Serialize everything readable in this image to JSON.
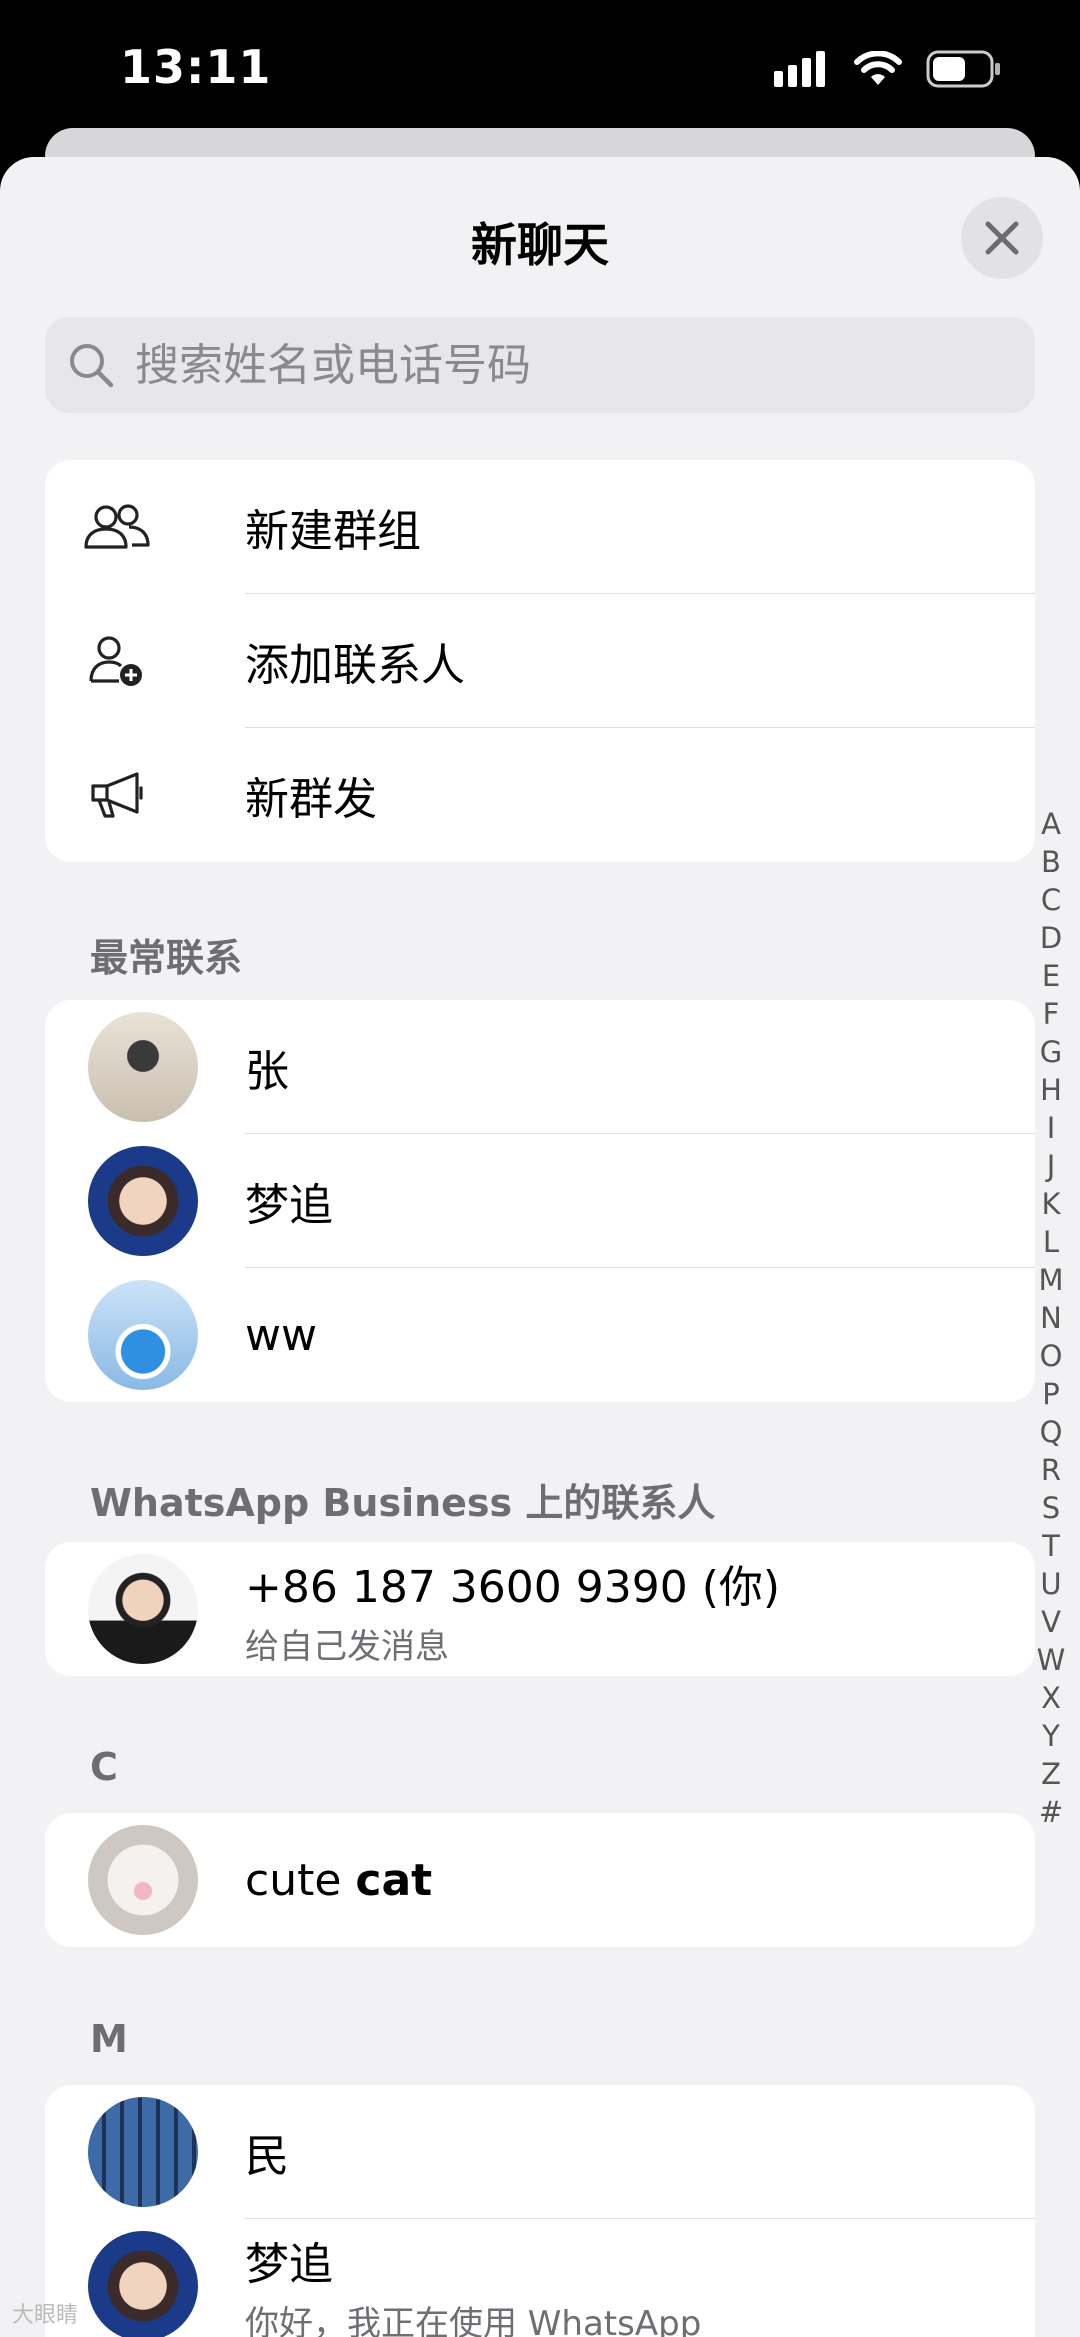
{
  "status": {
    "time": "13:11"
  },
  "sheet": {
    "title": "新聊天"
  },
  "search": {
    "placeholder": "搜索姓名或电话号码"
  },
  "actions": [
    {
      "label": "新建群组",
      "icon": "group-icon"
    },
    {
      "label": "添加联系人",
      "icon": "add-contact-icon"
    },
    {
      "label": "新群发",
      "icon": "megaphone-icon"
    }
  ],
  "frequent": {
    "header": "最常联系",
    "contacts": [
      {
        "name": "张"
      },
      {
        "name": "梦追"
      },
      {
        "name": "ww"
      }
    ]
  },
  "business": {
    "header": "WhatsApp Business 上的联系人",
    "self": {
      "name": "+86 187 3600 9390 (你)",
      "subtitle": "给自己发消息"
    }
  },
  "section_c": {
    "header": "C",
    "contact": {
      "name_light": "cute ",
      "name_bold": "cat"
    }
  },
  "section_m": {
    "header": "M",
    "contacts": [
      {
        "name": "民"
      },
      {
        "name": "梦追",
        "subtitle": "你好，我正在使用 WhatsApp"
      }
    ]
  },
  "index": [
    "A",
    "B",
    "C",
    "D",
    "E",
    "F",
    "G",
    "H",
    "I",
    "J",
    "K",
    "L",
    "M",
    "N",
    "O",
    "P",
    "Q",
    "R",
    "S",
    "T",
    "U",
    "V",
    "W",
    "X",
    "Y",
    "Z",
    "#"
  ],
  "watermark": "大眼睛"
}
